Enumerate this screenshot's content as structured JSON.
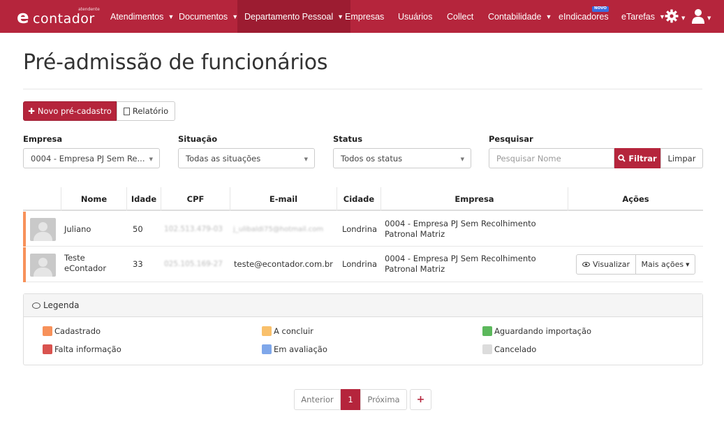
{
  "navbar": {
    "logo_tag": "atendente",
    "logo_mark": "e",
    "logo_word": "contador",
    "items": [
      {
        "label": "Atendimentos",
        "dropdown": true
      },
      {
        "label": "Documentos",
        "dropdown": true
      },
      {
        "label": "Departamento Pessoal",
        "dropdown": true,
        "active": true
      },
      {
        "label": "Empresas"
      },
      {
        "label": "Usuários"
      },
      {
        "label": "Collect"
      },
      {
        "label": "Contabilidade",
        "dropdown": true
      },
      {
        "label": "eIndicadores",
        "badge": "NOVO"
      },
      {
        "label": "eTarefas",
        "dropdown": true
      }
    ],
    "gear_icon": "gear-icon",
    "user_icon": "user-icon"
  },
  "page": {
    "title": "Pré-admissão de funcionários"
  },
  "toolbar": {
    "new_label": "Novo pré-cadastro",
    "report_label": "Relatório"
  },
  "filters": {
    "empresa": {
      "label": "Empresa",
      "value": "0004 - Empresa PJ Sem Re..."
    },
    "situacao": {
      "label": "Situação",
      "value": "Todas as situações"
    },
    "status": {
      "label": "Status",
      "value": "Todos os status"
    },
    "pesquisar": {
      "label": "Pesquisar",
      "placeholder": "Pesquisar Nome"
    },
    "filter_label": "Filtrar",
    "clear_label": "Limpar"
  },
  "table": {
    "headers": [
      "Nome",
      "Idade",
      "CPF",
      "E-mail",
      "Cidade",
      "Empresa",
      "Ações"
    ],
    "rows": [
      {
        "nome": "Juliano",
        "idade": "50",
        "cpf": "102.513.479-03",
        "email": "j_ulibaldi75@hotmail.com",
        "cidade": "Londrina",
        "empresa": "0004 - Empresa PJ Sem Recolhimento Patronal Matriz",
        "status_color": "#f7915a"
      },
      {
        "nome": "Teste eContador",
        "idade": "33",
        "cpf": "025.105.169-27",
        "email": "teste@econtador.com.br",
        "cidade": "Londrina",
        "empresa": "0004 - Empresa PJ Sem Recolhimento Patronal Matriz",
        "status_color": "#f7915a",
        "actions": {
          "view": "Visualizar",
          "more": "Mais ações"
        }
      }
    ]
  },
  "legend": {
    "title": "Legenda",
    "items": [
      {
        "label": "Cadastrado",
        "color": "#f7915a"
      },
      {
        "label": "A concluir",
        "color": "#f9c06b"
      },
      {
        "label": "Aguardando importação",
        "color": "#5cb85c"
      },
      {
        "label": "Falta informação",
        "color": "#d9534f"
      },
      {
        "label": "Em avaliação",
        "color": "#7fa7ea"
      },
      {
        "label": "Cancelado",
        "color": "#dcdcdc"
      }
    ]
  },
  "pagination": {
    "prev": "Anterior",
    "current": "1",
    "next": "Próxima",
    "add": "+"
  }
}
